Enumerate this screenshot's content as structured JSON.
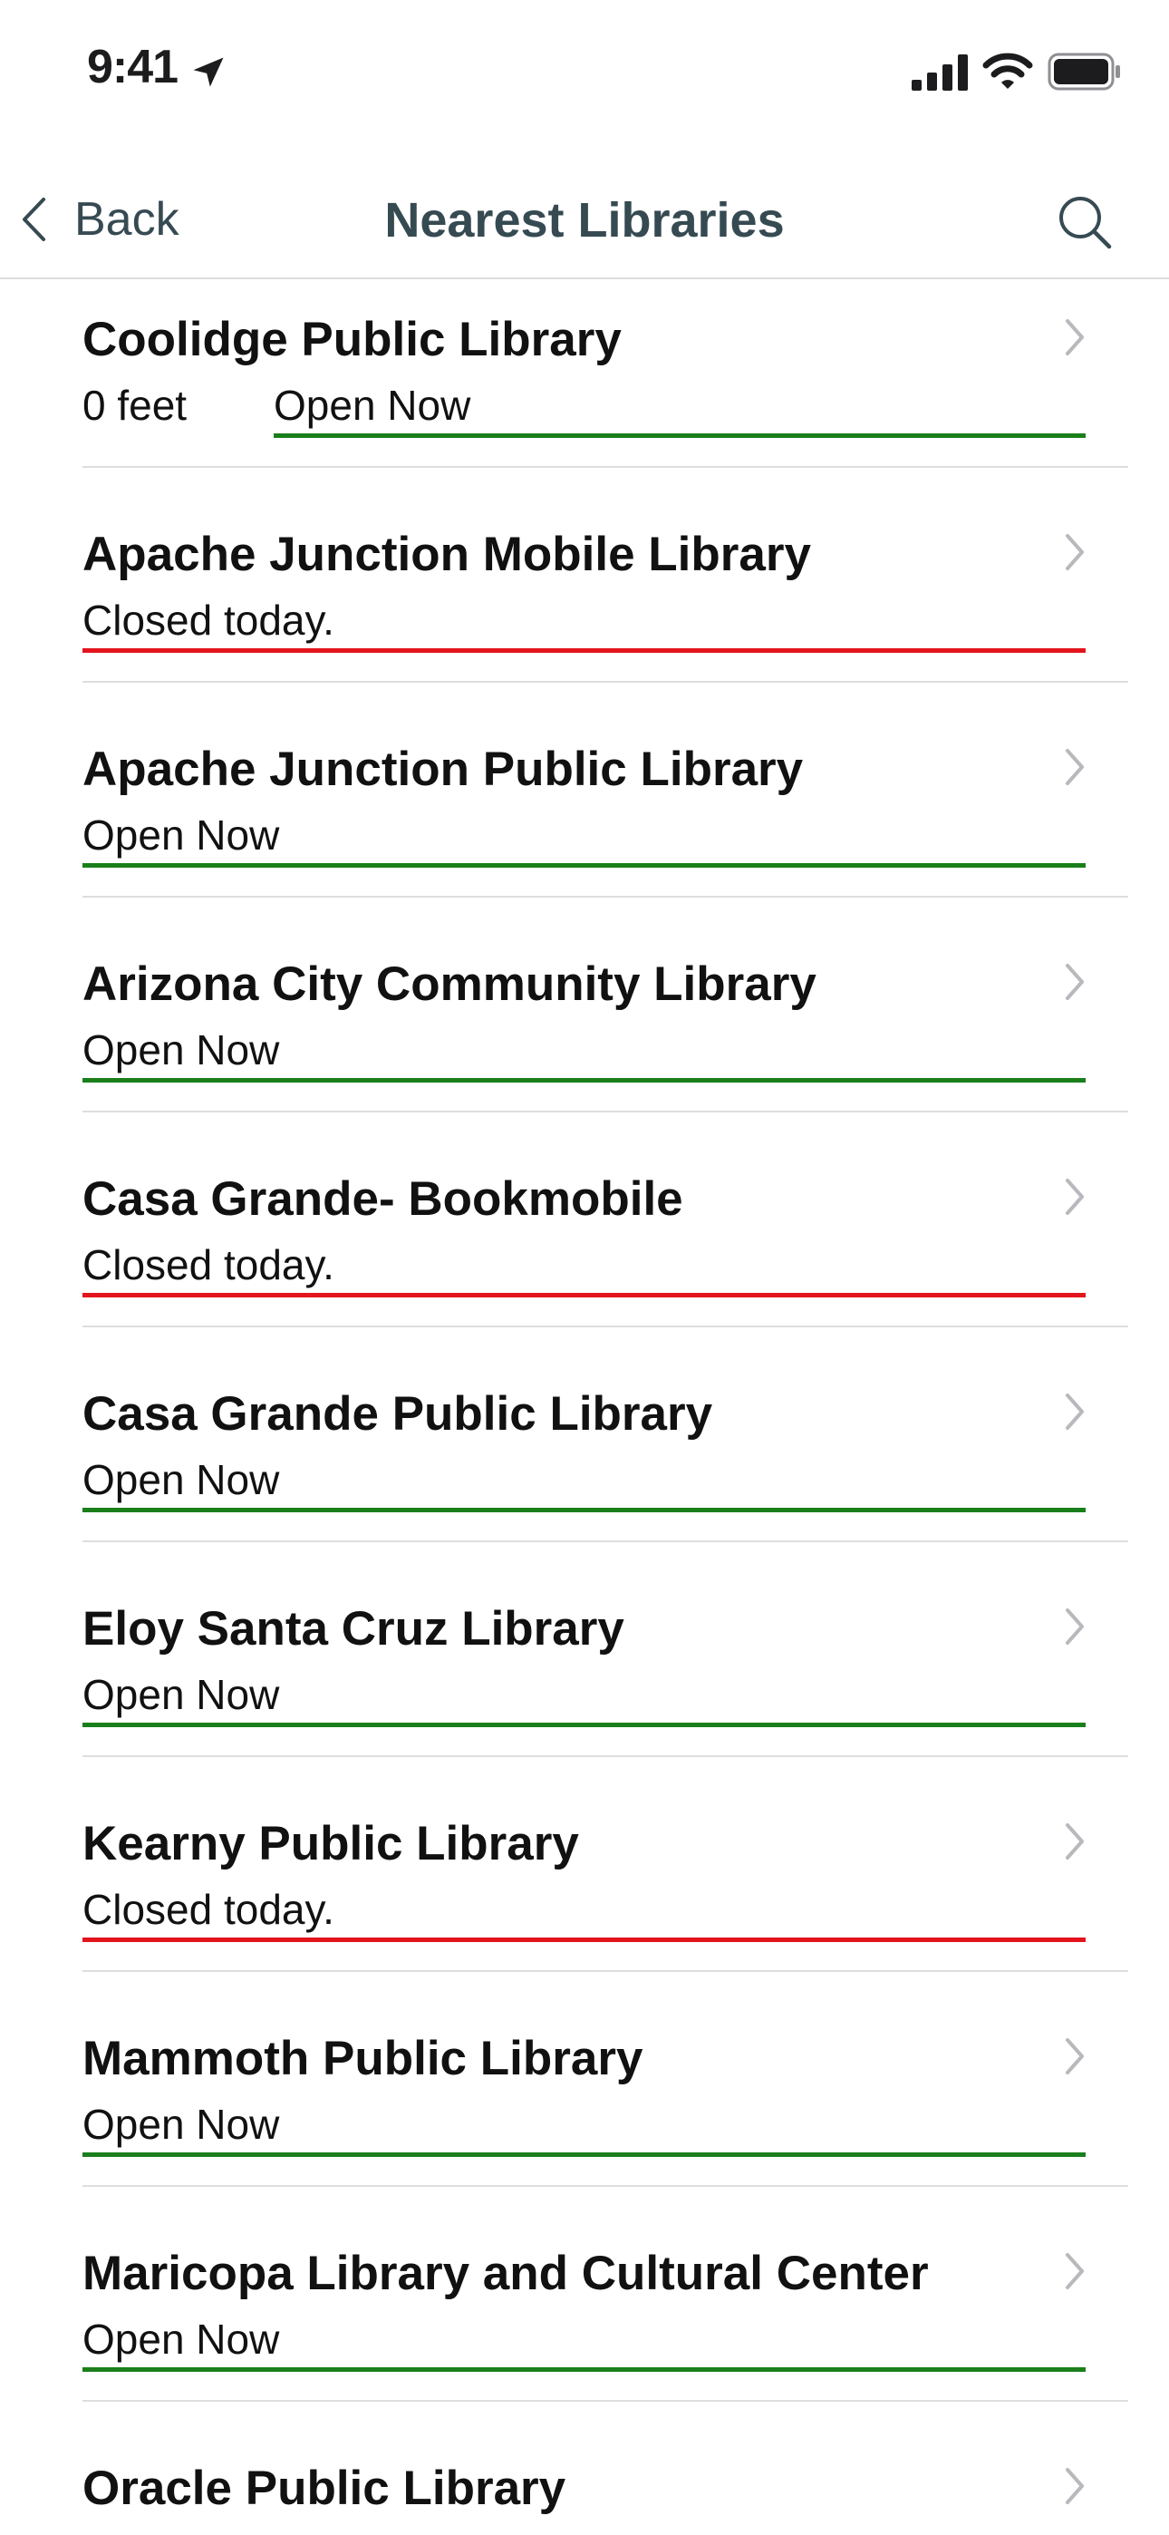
{
  "status_bar": {
    "time": "9:41",
    "icons": [
      "location-arrow-icon",
      "cellular-signal-icon",
      "wifi-icon",
      "battery-icon"
    ]
  },
  "nav": {
    "back_label": "Back",
    "title": "Nearest Libraries",
    "back_icon": "chevron-left-icon",
    "search_icon": "search-icon"
  },
  "colors": {
    "open": "#1a7f1a",
    "closed": "#e3141b",
    "nav_text": "#364a52",
    "chevron": "#b8b8bd",
    "divider": "#dedede"
  },
  "libraries": [
    {
      "name": "Coolidge Public Library",
      "distance": "0 feet",
      "status": "Open Now",
      "state": "open"
    },
    {
      "name": "Apache Junction Mobile Library",
      "distance": "",
      "status": "Closed today.",
      "state": "closed"
    },
    {
      "name": "Apache Junction Public Library",
      "distance": "",
      "status": "Open Now",
      "state": "open"
    },
    {
      "name": "Arizona City Community Library",
      "distance": "",
      "status": "Open Now",
      "state": "open"
    },
    {
      "name": "Casa Grande- Bookmobile",
      "distance": "",
      "status": "Closed today.",
      "state": "closed"
    },
    {
      "name": "Casa Grande Public Library",
      "distance": "",
      "status": "Open Now",
      "state": "open"
    },
    {
      "name": "Eloy Santa Cruz Library",
      "distance": "",
      "status": "Open Now",
      "state": "open"
    },
    {
      "name": "Kearny Public Library",
      "distance": "",
      "status": "Closed today.",
      "state": "closed"
    },
    {
      "name": "Mammoth Public Library",
      "distance": "",
      "status": "Open Now",
      "state": "open"
    },
    {
      "name": "Maricopa Library and Cultural Center",
      "distance": "",
      "status": "Open Now",
      "state": "open"
    },
    {
      "name": "Oracle Public Library",
      "distance": "",
      "status": "",
      "state": ""
    }
  ]
}
